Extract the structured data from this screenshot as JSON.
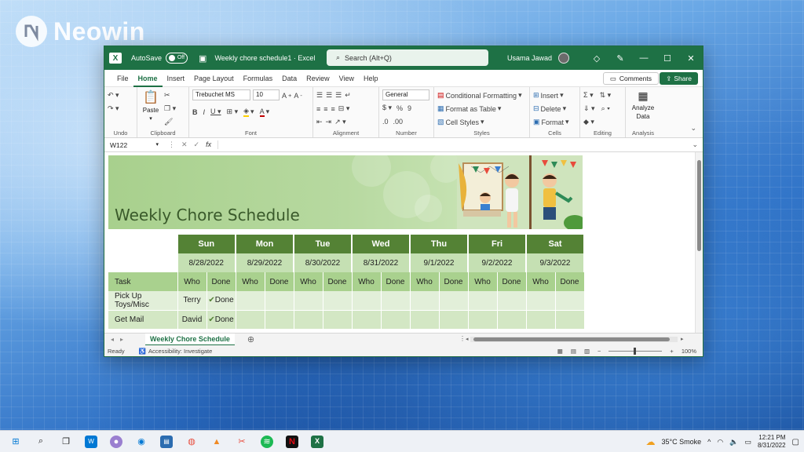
{
  "watermark": {
    "brand": "Neowin"
  },
  "window": {
    "autosave_label": "AutoSave",
    "autosave_state": "Off",
    "doc_title": "Weekly chore schedule1 · Excel",
    "search_placeholder": "Search (Alt+Q)",
    "user_name": "Usama Jawad"
  },
  "menu": {
    "tabs": [
      "File",
      "Home",
      "Insert",
      "Page Layout",
      "Formulas",
      "Data",
      "Review",
      "View",
      "Help"
    ],
    "active": "Home",
    "comments": "Comments",
    "share": "Share"
  },
  "ribbon": {
    "undo_label": "Undo",
    "clipboard_label": "Clipboard",
    "paste_label": "Paste",
    "font_label": "Font",
    "font_name": "Trebuchet MS",
    "font_size": "10",
    "alignment_label": "Alignment",
    "number_label": "Number",
    "number_format": "General",
    "styles_label": "Styles",
    "conditional_formatting": "Conditional Formatting",
    "format_as_table": "Format as Table",
    "cell_styles": "Cell Styles",
    "cells_label": "Cells",
    "insert": "Insert",
    "delete": "Delete",
    "format": "Format",
    "editing_label": "Editing",
    "analysis_label": "Analysis",
    "analyze_data_1": "Analyze",
    "analyze_data_2": "Data"
  },
  "formula_bar": {
    "name_box": "W122",
    "formula": ""
  },
  "sheet": {
    "title": "Weekly Chore Schedule",
    "days": [
      "Sun",
      "Mon",
      "Tue",
      "Wed",
      "Thu",
      "Fri",
      "Sat"
    ],
    "dates": [
      "8/28/2022",
      "8/29/2022",
      "8/30/2022",
      "8/31/2022",
      "9/1/2022",
      "9/2/2022",
      "9/3/2022"
    ],
    "task_header": "Task",
    "who": "Who",
    "done": "Done",
    "rows": [
      {
        "task": "Pick Up Toys/Misc",
        "who": "Terry",
        "done": "Done"
      },
      {
        "task": "Get Mail",
        "who": "David",
        "done": "Done"
      }
    ]
  },
  "tabs": {
    "sheet_name": "Weekly Chore Schedule"
  },
  "status": {
    "ready": "Ready",
    "accessibility": "Accessibility: Investigate",
    "zoom": "100%"
  },
  "taskbar": {
    "weather": "35°C  Smoke",
    "time": "12:21 PM",
    "date": "8/31/2022"
  },
  "colors": {
    "excel_green": "#1e7145",
    "table_header": "#548235",
    "banner": "#a8d08d"
  }
}
